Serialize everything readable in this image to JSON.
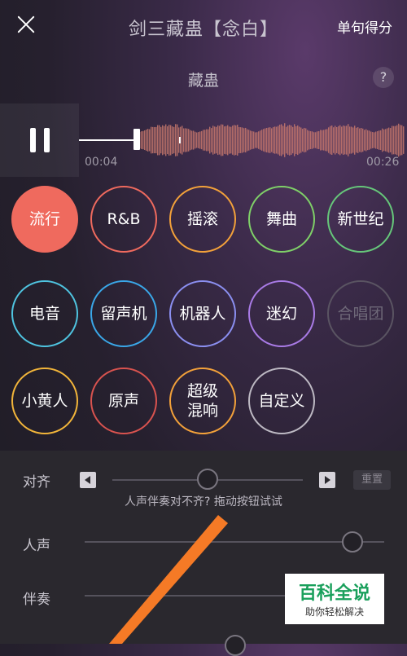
{
  "header": {
    "title": "剑三藏蛊【念白】",
    "score_link": "单句得分"
  },
  "song": {
    "name": "藏蛊",
    "help_label": "?"
  },
  "player": {
    "time_current": "00:04",
    "time_total": "00:26",
    "progress": 0.15
  },
  "effects": [
    {
      "label": "流行",
      "color": "#ef6a5e",
      "state": "active"
    },
    {
      "label": "R&B",
      "color": "#ef6a5e",
      "state": "normal"
    },
    {
      "label": "摇滚",
      "color": "#f3a13a",
      "state": "normal"
    },
    {
      "label": "舞曲",
      "color": "#7fd068",
      "state": "normal"
    },
    {
      "label": "新世纪",
      "color": "#66c77a",
      "state": "normal"
    },
    {
      "label": "电音",
      "color": "#4fc4e0",
      "state": "normal"
    },
    {
      "label": "留声机",
      "color": "#3aa7e8",
      "state": "normal"
    },
    {
      "label": "机器人",
      "color": "#8b8ff0",
      "state": "normal"
    },
    {
      "label": "迷幻",
      "color": "#a97be6",
      "state": "normal"
    },
    {
      "label": "合唱团",
      "color": "#5a5462",
      "state": "disabled"
    },
    {
      "label": "小黄人",
      "color": "#f2b53a",
      "state": "normal"
    },
    {
      "label": "原声",
      "color": "#d9534f",
      "state": "normal"
    },
    {
      "label": "超级\n混响",
      "color": "#f3a13a",
      "state": "normal"
    },
    {
      "label": "自定义",
      "color": "#bdb9c3",
      "state": "normal"
    }
  ],
  "controls": {
    "align_label": "对齐",
    "align_hint": "人声伴奏对不齐? 拖动按钮试试",
    "reset_label": "重置",
    "align_value": 0.5,
    "vocal_label": "人声",
    "vocal_value": 0.93,
    "accompaniment_label": "伴奏"
  },
  "watermark": {
    "title": "百科全说",
    "subtitle": "助你轻松解决"
  }
}
